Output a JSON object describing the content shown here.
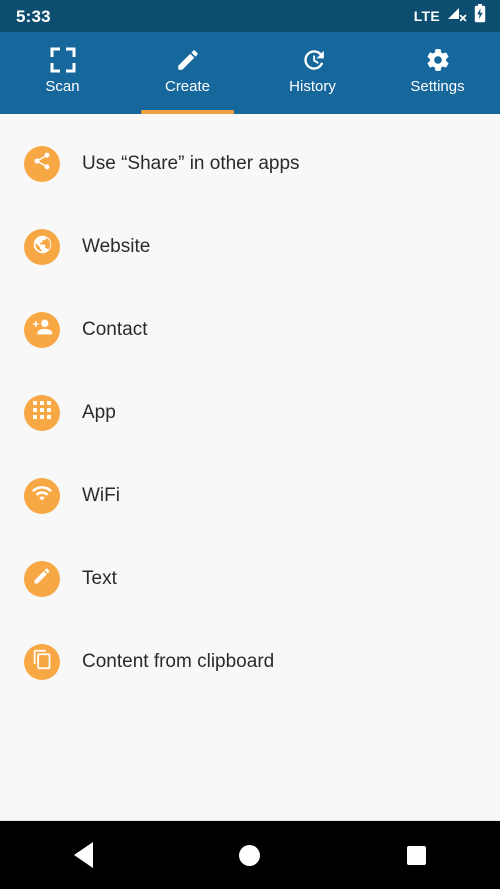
{
  "status_bar": {
    "clock": "5:33",
    "network_label": "LTE",
    "signal_icon": "signal-no-service-icon",
    "battery_icon": "battery-charging-icon",
    "background_color": "#0d4e70"
  },
  "tab_bar": {
    "background_color": "#15679c",
    "indicator_color": "#f0a044",
    "active_index": 1,
    "tabs": [
      {
        "label": "Scan",
        "icon": "scan-frame-icon"
      },
      {
        "label": "Create",
        "icon": "pencil-icon"
      },
      {
        "label": "History",
        "icon": "history-clock-icon"
      },
      {
        "label": "Settings",
        "icon": "gear-icon"
      }
    ]
  },
  "content": {
    "background_color": "#f8f8f8",
    "badge_color": "#f7a845",
    "items": [
      {
        "label": "Use “Share” in other apps",
        "icon": "share-icon"
      },
      {
        "label": "Website",
        "icon": "globe-icon"
      },
      {
        "label": "Contact",
        "icon": "person-add-icon"
      },
      {
        "label": "App",
        "icon": "apps-grid-icon"
      },
      {
        "label": "WiFi",
        "icon": "wifi-icon"
      },
      {
        "label": "Text",
        "icon": "pencil-icon"
      },
      {
        "label": "Content from clipboard",
        "icon": "copy-clipboard-icon"
      }
    ]
  },
  "nav_bar": {
    "background_color": "#000000",
    "buttons": [
      {
        "name": "back",
        "icon": "triangle-back-icon"
      },
      {
        "name": "home",
        "icon": "circle-home-icon"
      },
      {
        "name": "recents",
        "icon": "square-recents-icon"
      }
    ]
  }
}
